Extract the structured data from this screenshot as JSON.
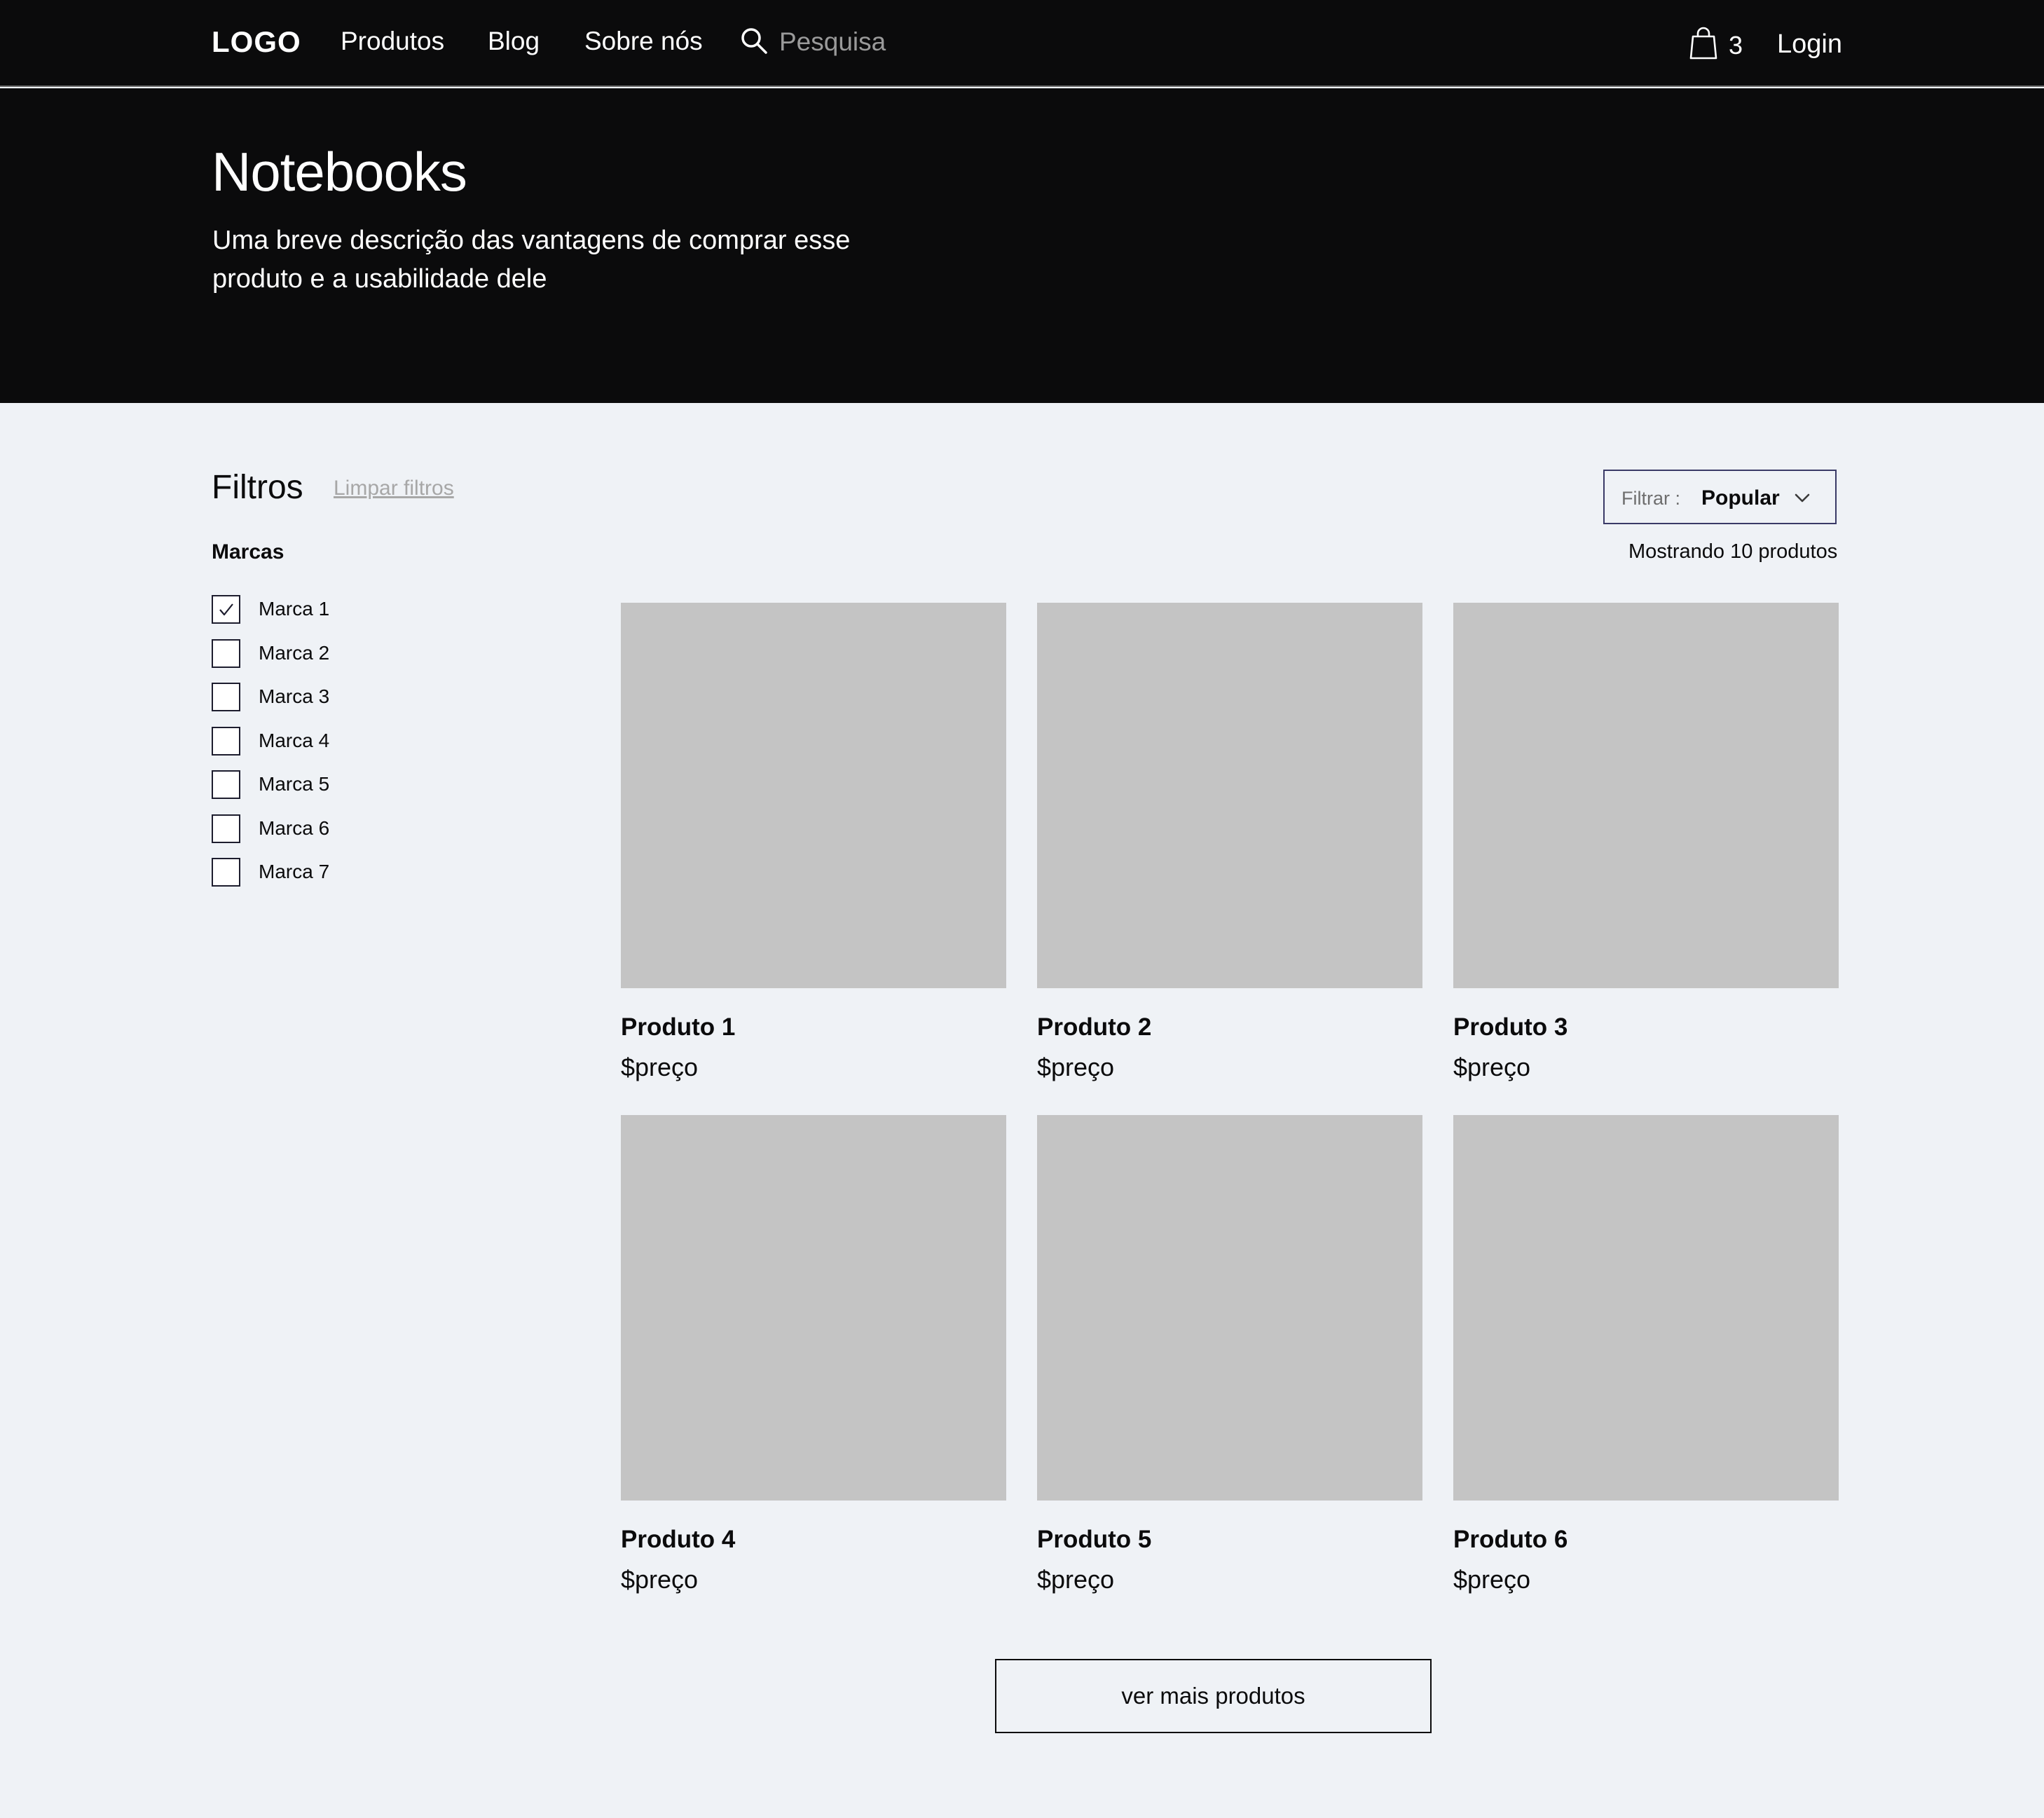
{
  "nav": {
    "logo": "LOGO",
    "links": [
      "Produtos",
      "Blog",
      "Sobre nós"
    ],
    "search_placeholder": "Pesquisa",
    "cart_count": "3",
    "login": "Login"
  },
  "hero": {
    "title": "Notebooks",
    "description": "Uma breve descrição das vantagens de comprar esse produto e  a  usabilidade dele"
  },
  "filters": {
    "title": "Filtros",
    "clear": "Limpar filtros",
    "brands_heading": "Marcas",
    "brands": [
      {
        "label": "Marca 1",
        "checked": true
      },
      {
        "label": "Marca 2",
        "checked": false
      },
      {
        "label": "Marca 3",
        "checked": false
      },
      {
        "label": "Marca 4",
        "checked": false
      },
      {
        "label": "Marca 5",
        "checked": false
      },
      {
        "label": "Marca 6",
        "checked": false
      },
      {
        "label": "Marca 7",
        "checked": false
      }
    ]
  },
  "sort": {
    "label": "Filtrar :",
    "value": "Popular"
  },
  "result_count": "Mostrando 10 produtos",
  "products": [
    {
      "name": "Produto 1",
      "price": "$preço"
    },
    {
      "name": "Produto 2",
      "price": "$preço"
    },
    {
      "name": "Produto 3",
      "price": "$preço"
    },
    {
      "name": "Produto 4",
      "price": "$preço"
    },
    {
      "name": "Produto 5",
      "price": "$preço"
    },
    {
      "name": "Produto 6",
      "price": "$preço"
    }
  ],
  "load_more": "ver mais produtos",
  "colors": {
    "nav_bg": "#0b0b0c",
    "page_bg": "#eff2f6",
    "placeholder_image": "#c4c4c4",
    "sort_border": "#3a3a67",
    "muted_text": "#a7a7a7"
  }
}
